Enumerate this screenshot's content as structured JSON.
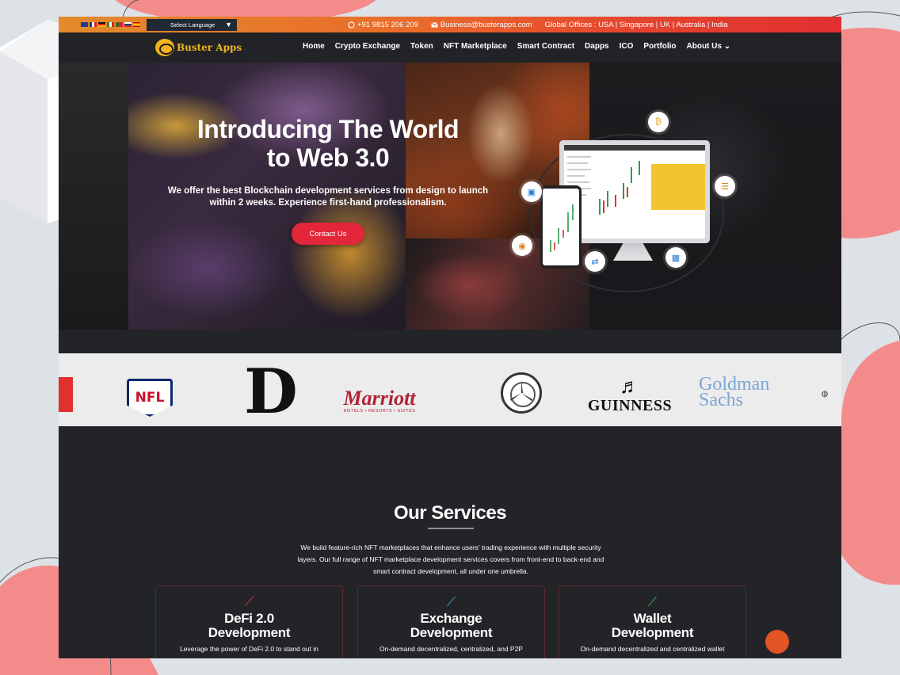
{
  "topbar": {
    "language_label": "Select Language",
    "language_caret": "▼",
    "phone_icon": "whatsapp-icon",
    "phone": "+91 9815 206 209",
    "email_icon": "mail-icon",
    "email": "Business@busterapps.com",
    "offices": "Global Offices : USA | Singapore | UK | Australia | India",
    "flags": [
      "gb",
      "fr",
      "de",
      "it",
      "pt",
      "ru",
      "es"
    ]
  },
  "nav": {
    "brand": "Buster Apps",
    "items": [
      "Home",
      "Crypto Exchange",
      "Token",
      "NFT Marketplace",
      "Smart Contract",
      "Dapps",
      "ICO",
      "Portfolio",
      "About Us"
    ],
    "about_caret": "⌄"
  },
  "hero": {
    "title_line1": "Introducing The World",
    "title_line2": "to Web 3.0",
    "subtitle_line1": "We offer the best Blockchain development services from design to launch",
    "subtitle_line2": "within 2 weeks. Experience first-hand professionalism.",
    "cta": "Contact Us"
  },
  "clients": {
    "nfl": "NFL",
    "disney": "D",
    "marriott": "Marriott",
    "marriott_tag": "HOTELS • RESORTS • SUITES",
    "guinness": "GUINNESS",
    "goldman_line1": "Goldman",
    "goldman_line2": "Sachs",
    "harp_icon": "harp-icon",
    "mercedes_icon": "mercedes-star-icon"
  },
  "services": {
    "title_a": "Our",
    "title_b": "Services",
    "desc_line1": "We build feature-rich NFT marketplaces that enhance users' trading experience with multiple security",
    "desc_line2": "layers. Our full range of NFT marketplace development services covers from front-end to back-end and",
    "desc_line3": "smart contract development, all under one umbrella.",
    "cards": [
      {
        "icon": "chart-up-icon",
        "icon_color": "#e8333c",
        "title_line1": "DeFi 2.0",
        "title_line2": "Development",
        "desc": "Leverage the power of DeFi 2.0 to stand out in"
      },
      {
        "icon": "chart-up-icon",
        "icon_color": "#2bb3c8",
        "title_line1": "Exchange",
        "title_line2": "Development",
        "desc": "On-demand decentralized, centralized, and P2P"
      },
      {
        "icon": "chart-up-icon",
        "icon_color": "#2fbf5a",
        "title_line1": "Wallet",
        "title_line2": "Development",
        "desc": "On-demand decentralized and centralized wallet"
      }
    ]
  },
  "colors": {
    "accent": "#e3263a",
    "brand_gold": "#f0b41c",
    "page_dark": "#232428",
    "deco_pink": "#f48b8b"
  }
}
